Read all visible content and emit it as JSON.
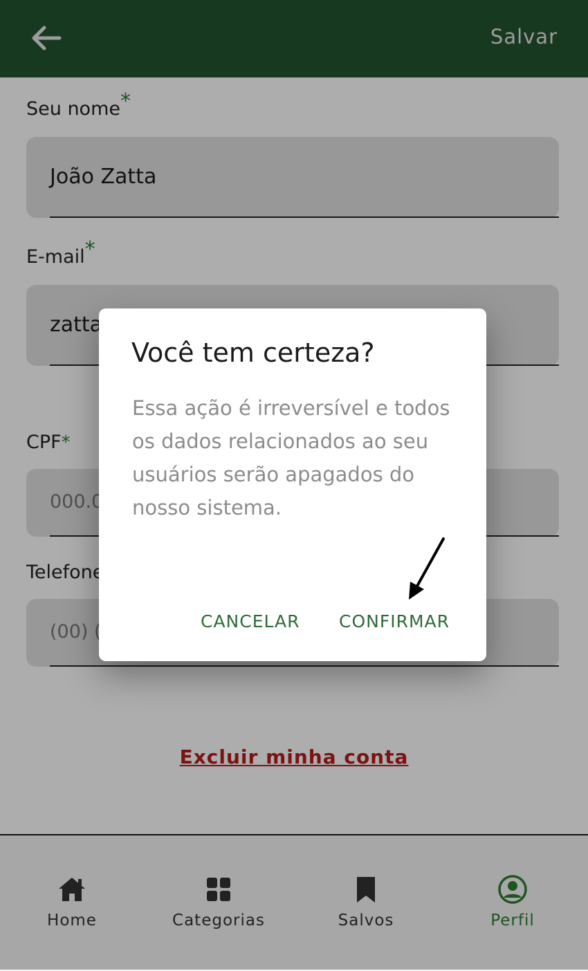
{
  "header": {
    "back_icon": "arrow-left-icon",
    "save_label": "Salvar",
    "background": "#23552f"
  },
  "form": {
    "name": {
      "label": "Seu nome",
      "required_mark": "*",
      "value": "João Zatta"
    },
    "email": {
      "label": "E-mail",
      "required_mark": "*",
      "value": "zatta"
    },
    "cpf": {
      "label": "CPF",
      "required_mark": "*",
      "placeholder": "000.0"
    },
    "phone": {
      "label": "Telefone",
      "placeholder": "(00) ("
    }
  },
  "delete_account": {
    "label": "Excluir minha conta",
    "color": "#b71c1c"
  },
  "dialog": {
    "title": "Você tem certeza?",
    "body": "Essa ação é irreversível e todos os dados relacionados ao seu usuários serão apagados do nosso sistema.",
    "cancel_label": "CANCELAR",
    "confirm_label": "CONFIRMAR"
  },
  "bottom_nav": {
    "items": [
      {
        "label": "Home",
        "icon": "home-icon"
      },
      {
        "label": "Categorias",
        "icon": "grid-icon"
      },
      {
        "label": "Salvos",
        "icon": "bookmark-icon"
      },
      {
        "label": "Perfil",
        "icon": "account-circle-icon",
        "active": true
      }
    ],
    "active_color": "#2e7d32"
  }
}
